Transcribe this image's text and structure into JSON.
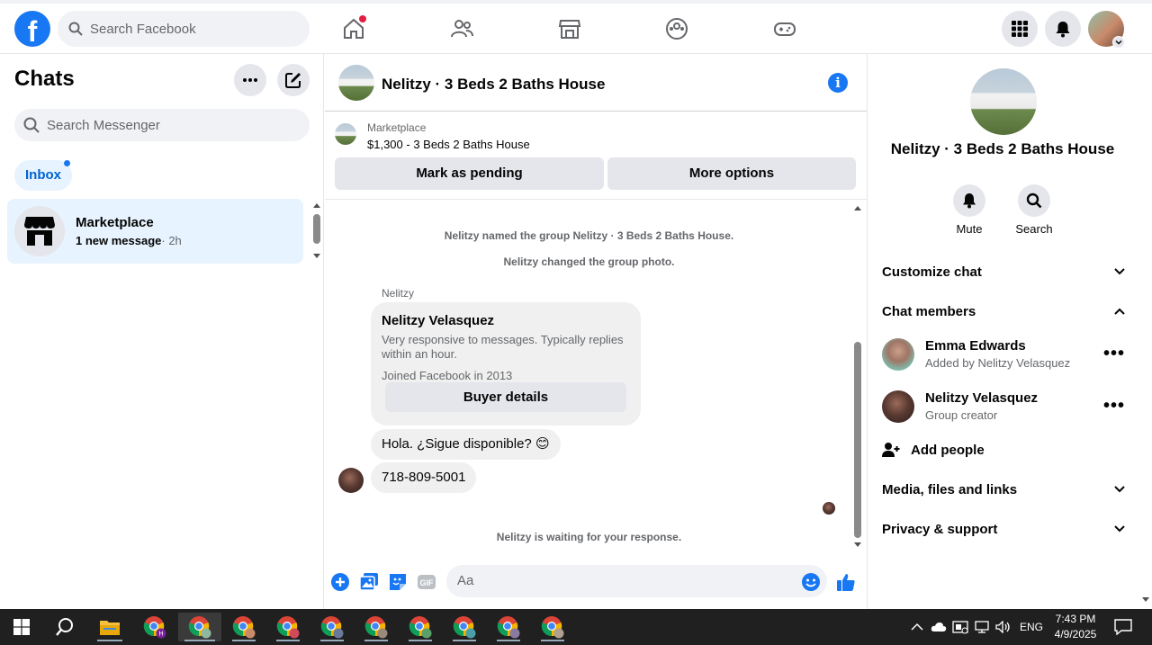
{
  "facebook": {
    "logo_letter": "f",
    "search_placeholder": "Search Facebook"
  },
  "nav": {
    "icons": [
      "home-icon",
      "friends-icon",
      "marketplace-icon",
      "groups-icon",
      "gaming-icon"
    ],
    "right_icons": [
      "menu-grid-icon",
      "notifications-bell-icon"
    ]
  },
  "chats": {
    "title": "Chats",
    "search_placeholder": "Search Messenger",
    "filter": "Inbox",
    "items": [
      {
        "name": "Marketplace",
        "preview": "1 new message",
        "time": "· 2h"
      }
    ]
  },
  "conversation": {
    "title": "Nelitzy · 3 Beds 2 Baths House",
    "marketplace_label": "Marketplace",
    "listing": "$1,300 - 3 Beds 2 Baths House",
    "buttons": {
      "pending": "Mark as pending",
      "more": "More options"
    },
    "system_messages": [
      "Nelitzy named the group Nelitzy · 3 Beds 2 Baths House.",
      "Nelitzy changed the group photo."
    ],
    "sender_label": "Nelitzy",
    "profile_card": {
      "name": "Nelitzy Velasquez",
      "desc": "Very responsive to messages. Typically replies within an hour.",
      "joined": "Joined Facebook in 2013",
      "button": "Buyer details"
    },
    "messages": [
      "Hola. ¿Sigue disponible? 😊",
      "718-809-5001"
    ],
    "waiting": "Nelitzy is waiting for your response.",
    "composer_placeholder": "Aa"
  },
  "details": {
    "title": "Nelitzy · 3 Beds 2 Baths House",
    "actions": [
      "Mute",
      "Search"
    ],
    "sections": {
      "customize": "Customize chat",
      "members": "Chat members",
      "media": "Media, files and links",
      "privacy": "Privacy & support"
    },
    "members": [
      {
        "name": "Emma Edwards",
        "sub": "Added by Nelitzy Velasquez"
      },
      {
        "name": "Nelitzy Velasquez",
        "sub": "Group creator"
      }
    ],
    "add_people": "Add people"
  },
  "taskbar": {
    "lang": "ENG",
    "time": "7:43 PM",
    "date": "4/9/2025"
  },
  "colors": {
    "brand": "#1877f2",
    "selected_bg": "#e7f3ff",
    "taskbar": "#202020"
  }
}
